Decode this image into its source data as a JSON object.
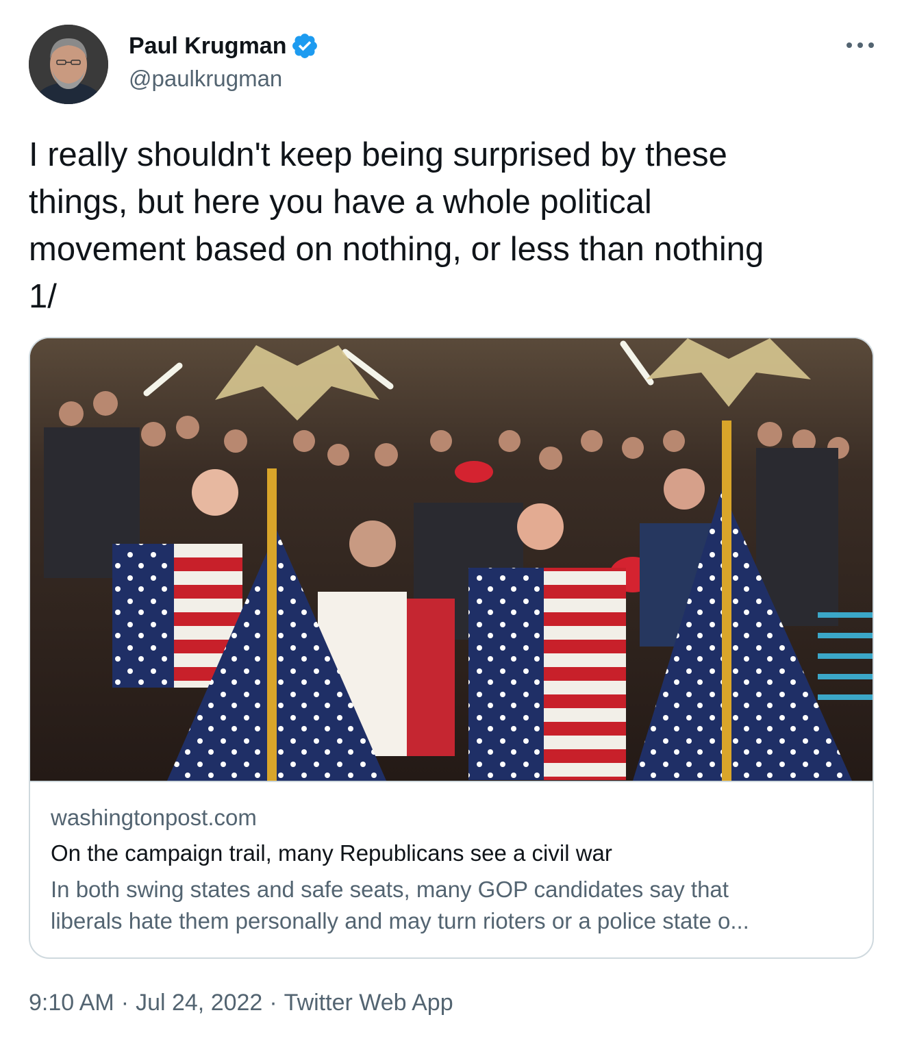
{
  "author": {
    "display_name": "Paul Krugman",
    "handle": "@paulkrugman",
    "verified": true,
    "avatar_icon": "profile-photo"
  },
  "more_icon": "more-horizontal-icon",
  "tweet": {
    "text": "I really shouldn't keep being surprised by these\nthings, but here you have a whole political\nmovement based on nothing, or less than nothing\n1/"
  },
  "card": {
    "image_description_icon": "rally-photo",
    "domain": "washingtonpost.com",
    "title": "On the campaign trail, many Republicans see a civil war",
    "description": "In both swing states and safe seats, many GOP candidates say that\nliberals hate them personally and may turn rioters or a police state o..."
  },
  "meta": {
    "time": "9:10 AM",
    "date": "Jul 24, 2022",
    "source": "Twitter Web App",
    "separator": "·"
  },
  "colors": {
    "text_primary": "#0f1419",
    "text_secondary": "#536471",
    "verified_blue": "#1d9bf0",
    "border": "#cfd9de"
  }
}
